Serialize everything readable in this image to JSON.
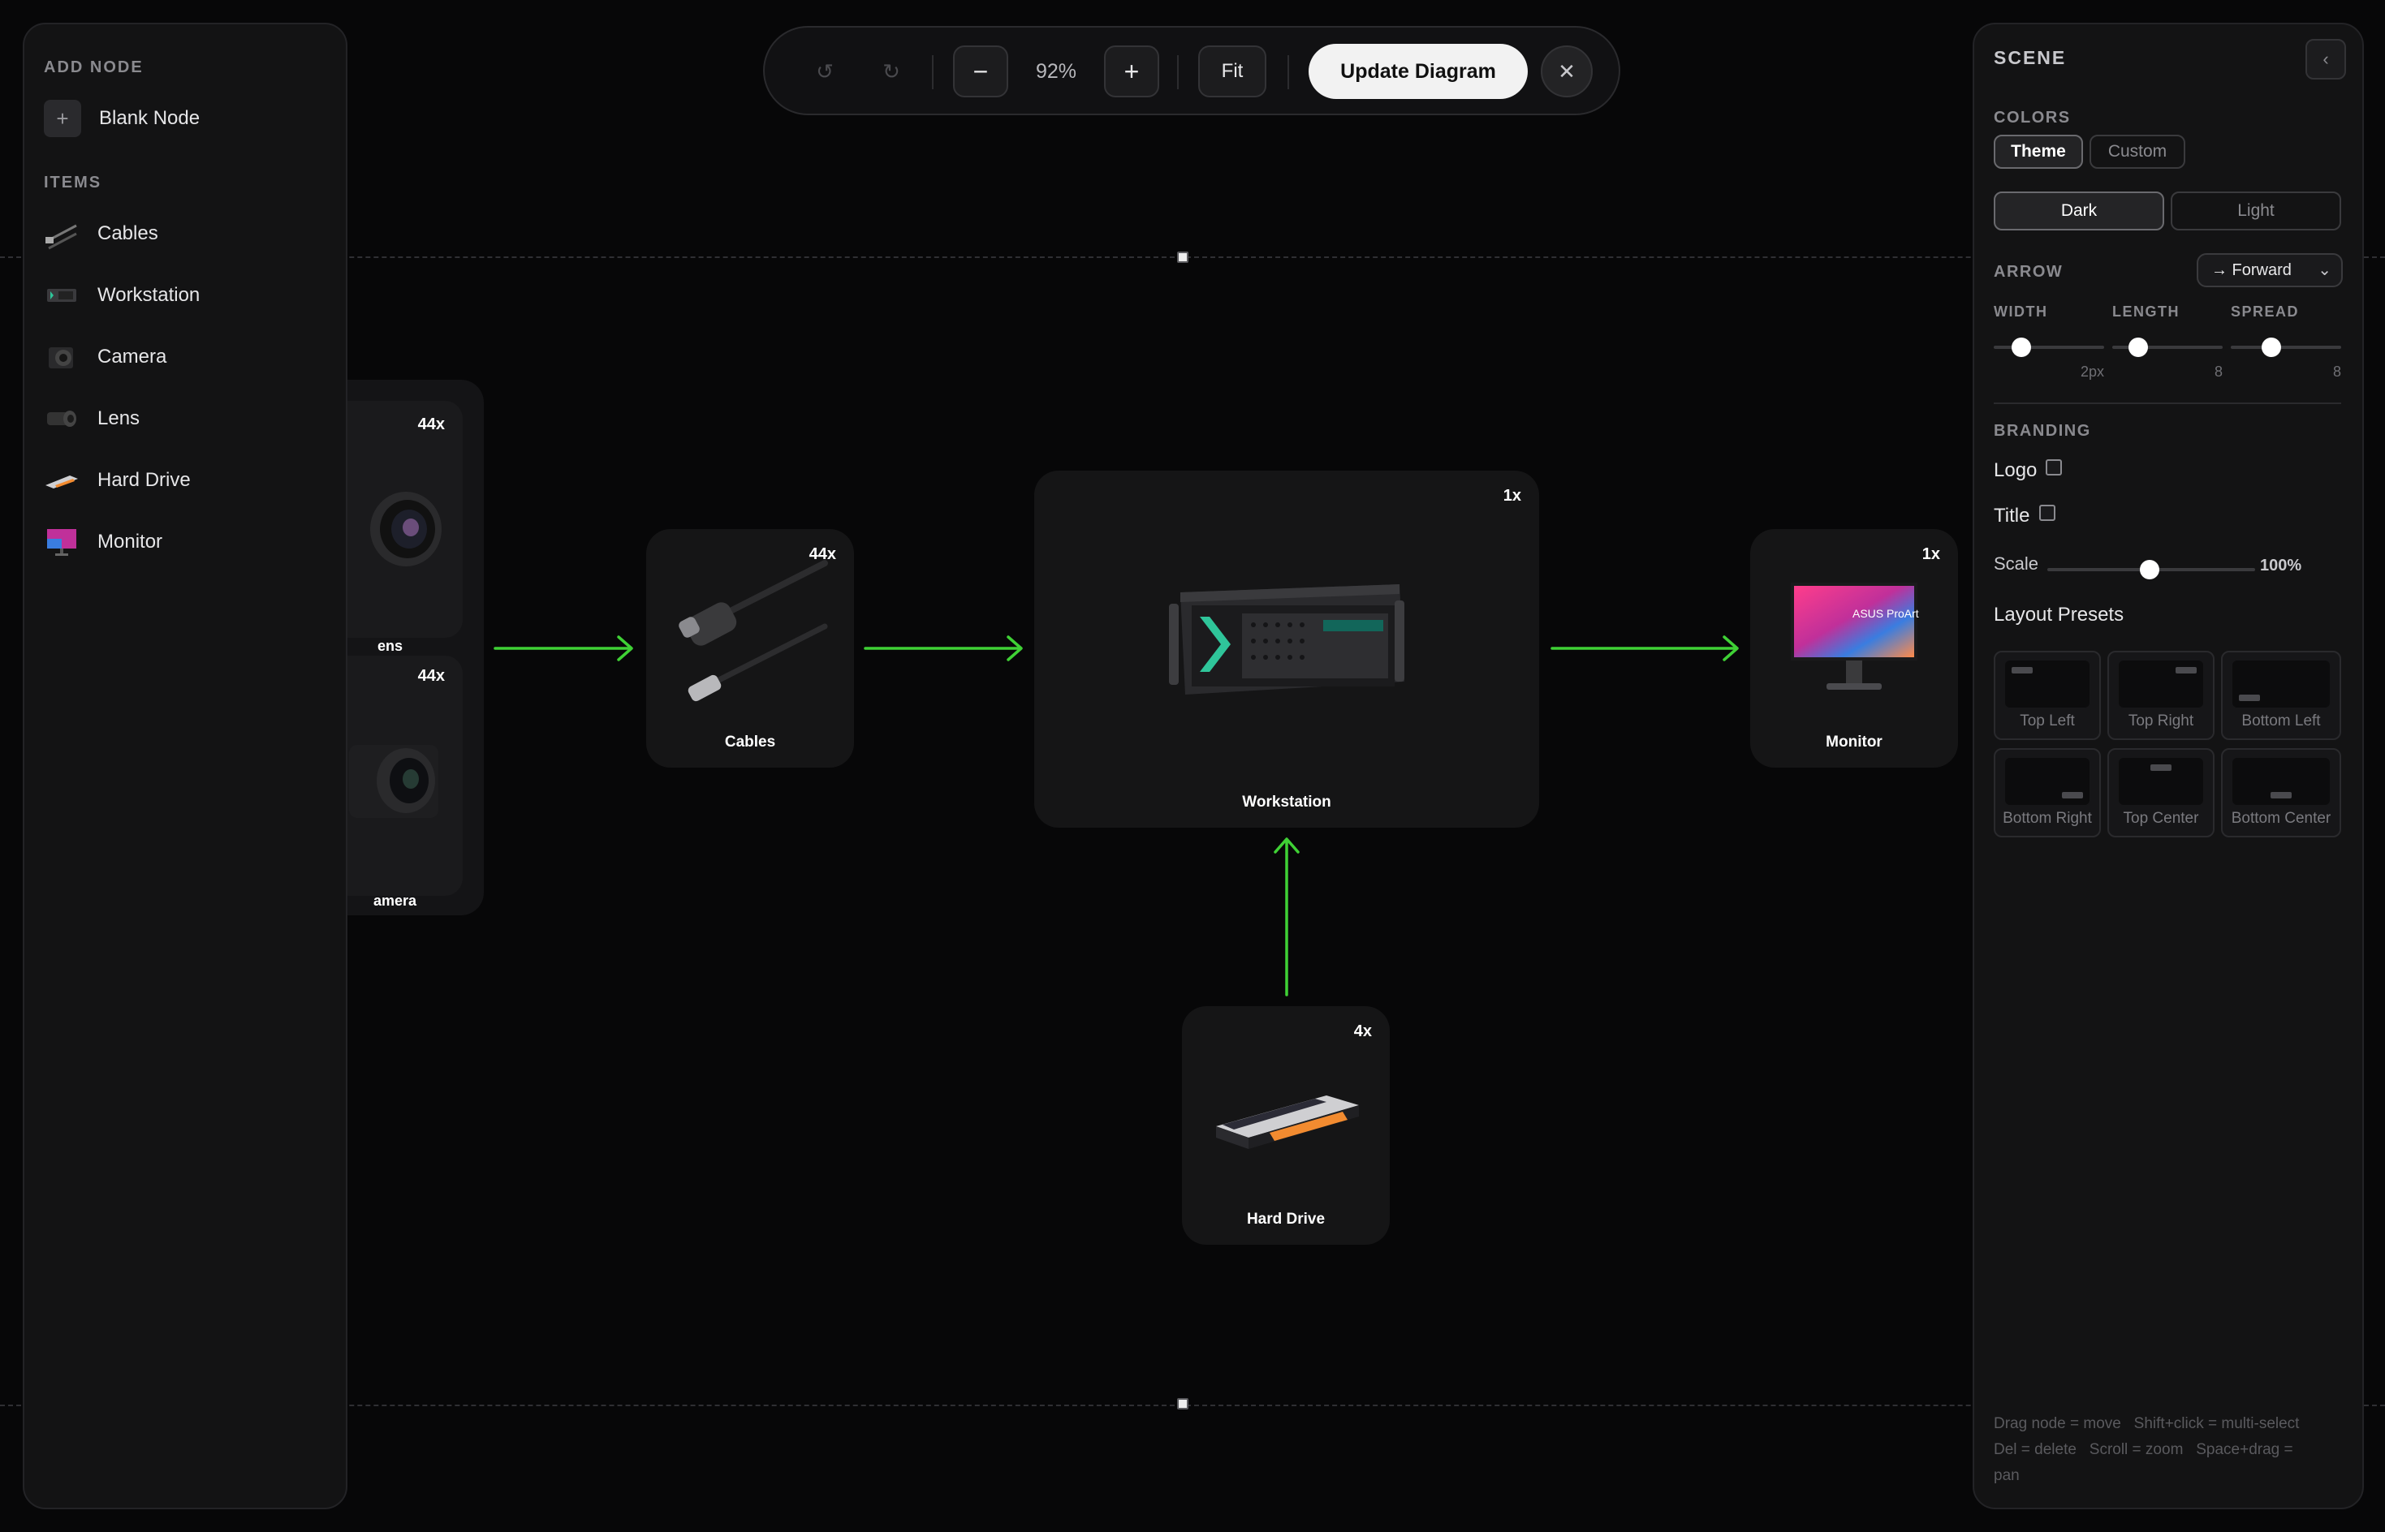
{
  "toolbar": {
    "undo_icon": "undo-icon",
    "redo_icon": "redo-icon",
    "zoom_out_label": "−",
    "zoom_level": "92%",
    "zoom_in_label": "+",
    "fit_label": "Fit",
    "update_label": "Update Diagram",
    "close_label": "✕"
  },
  "left_panel": {
    "add_node_title": "ADD NODE",
    "blank_node_label": "Blank Node",
    "items_title": "ITEMS",
    "items": [
      {
        "label": "Cables",
        "icon": "cable-icon"
      },
      {
        "label": "Workstation",
        "icon": "workstation-icon"
      },
      {
        "label": "Camera",
        "icon": "camera-icon"
      },
      {
        "label": "Lens",
        "icon": "lens-icon"
      },
      {
        "label": "Hard Drive",
        "icon": "hard-drive-icon"
      },
      {
        "label": "Monitor",
        "icon": "monitor-icon"
      }
    ]
  },
  "diagram": {
    "group": {
      "lens": {
        "count": "44x",
        "label": "ens"
      },
      "camera": {
        "count": "44x",
        "label": "amera"
      }
    },
    "cables": {
      "count": "44x",
      "label": "Cables"
    },
    "workstation": {
      "count": "1x",
      "label": "Workstation"
    },
    "monitor": {
      "count": "1x",
      "label": "Monitor",
      "brand": "ASUS ProArt"
    },
    "hard_drive": {
      "count": "4x",
      "label": "Hard Drive"
    },
    "arrow_color": "#3fd135"
  },
  "right_panel": {
    "title": "SCENE",
    "collapse_icon": "chevron-left-icon",
    "colors_label": "COLORS",
    "colors_tabs": [
      "Theme",
      "Custom"
    ],
    "theme_modes": [
      "Dark",
      "Light"
    ],
    "arrow_label": "ARROW",
    "arrow_direction": "→ Forward",
    "sliders": [
      {
        "label": "WIDTH",
        "value": "2px"
      },
      {
        "label": "LENGTH",
        "value": "8"
      },
      {
        "label": "SPREAD",
        "value": "8"
      }
    ],
    "branding_label": "BRANDING",
    "logo_label": "Logo",
    "title_label": "Title",
    "scale_label": "Scale",
    "scale_value": "100%",
    "presets_label": "Layout Presets",
    "presets": [
      "Top Left",
      "Top Right",
      "Bottom Left",
      "Bottom Right",
      "Top Center",
      "Bottom Center"
    ],
    "help_text_1": "Drag node = move   Shift+click = multi-select",
    "help_text_2": "Del = delete   Scroll = zoom   Space+drag =",
    "help_text_3": "pan"
  }
}
